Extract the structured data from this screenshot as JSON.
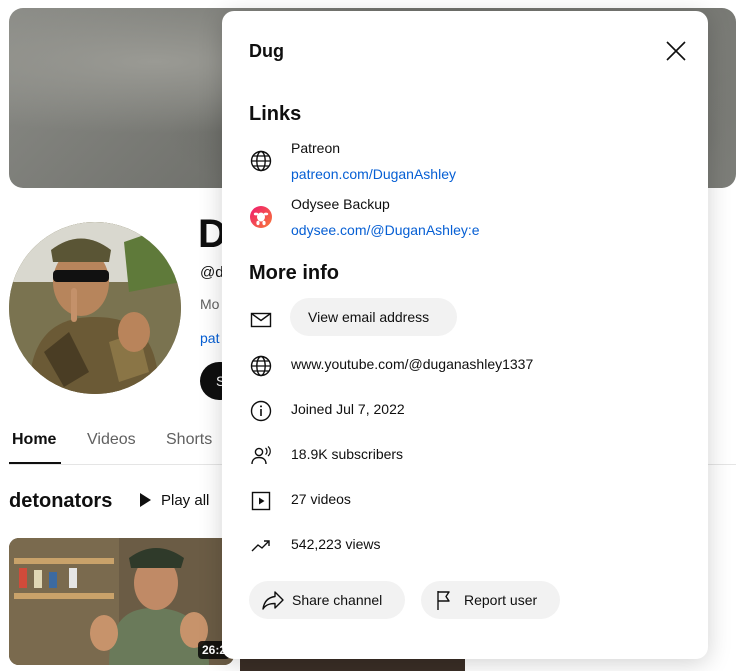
{
  "background": {
    "channel_initial": "D",
    "handle_partial": "@d",
    "more_partial": "Mo",
    "link_partial": "pat",
    "subscribe_partial": "S",
    "tabs": [
      {
        "label": "Home",
        "active": true
      },
      {
        "label": "Videos",
        "active": false
      },
      {
        "label": "Shorts",
        "active": false
      }
    ],
    "shelf": {
      "title": "detonators",
      "play_all": "Play all",
      "video_duration_partial": "26:2"
    }
  },
  "modal": {
    "title": "Dug",
    "links_heading": "Links",
    "links": [
      {
        "name": "Patreon",
        "url": "patreon.com/DuganAshley",
        "icon": "globe-icon"
      },
      {
        "name": "Odysee Backup",
        "url": "odysee.com/@DuganAshley:e",
        "icon": "odysee-icon"
      }
    ],
    "more_info_heading": "More info",
    "email_button": "View email address",
    "channel_url": "www.youtube.com/@duganashley1337",
    "joined": "Joined Jul 7, 2022",
    "subscribers": "18.9K subscribers",
    "videos": "27 videos",
    "views": "542,223 views",
    "share_button": "Share channel",
    "report_button": "Report user"
  },
  "colors": {
    "link": "#065fd4",
    "pill_bg": "#f2f2f2",
    "text": "#0f0f0f"
  }
}
